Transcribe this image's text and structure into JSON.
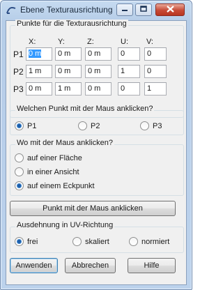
{
  "window": {
    "title": "Ebene Texturausrichtung"
  },
  "points_group": {
    "legend": "Punkte für die Texturausrichtung",
    "columns": [
      "X:",
      "Y:",
      "Z:",
      "U:",
      "V:"
    ],
    "rows": [
      {
        "label": "P1",
        "x": "0 m",
        "y": "0 m",
        "z": "0 m",
        "u": "0",
        "v": "0"
      },
      {
        "label": "P2",
        "x": "1 m",
        "y": "0 m",
        "z": "0 m",
        "u": "1",
        "v": "0"
      },
      {
        "label": "P3",
        "x": "0 m",
        "y": "1 m",
        "z": "0 m",
        "u": "0",
        "v": "1"
      }
    ]
  },
  "point_select_group": {
    "legend": "Welchen Punkt mit der Maus anklicken?",
    "options": [
      "P1",
      "P2",
      "P3"
    ],
    "selected": "P1"
  },
  "click_where_group": {
    "legend": "Wo mit der Maus anklicken?",
    "options": [
      "auf einer Fläche",
      "in einer Ansicht",
      "auf einem Eckpunkt"
    ],
    "selected": "auf einem Eckpunkt"
  },
  "pick_button": {
    "label": "Punkt mit der Maus anklicken"
  },
  "uv_group": {
    "legend": "Ausdehnung in UV-Richtung",
    "options": [
      "frei",
      "skaliert",
      "normiert"
    ],
    "selected": "frei"
  },
  "footer": {
    "apply": "Anwenden",
    "cancel": "Abbrechen",
    "help": "Hilfe"
  },
  "colors": {
    "title_bar": "#bcd2ec",
    "selection": "#3399ff",
    "radio_dot": "#1e5ea8",
    "close_button": "#c74a36"
  }
}
